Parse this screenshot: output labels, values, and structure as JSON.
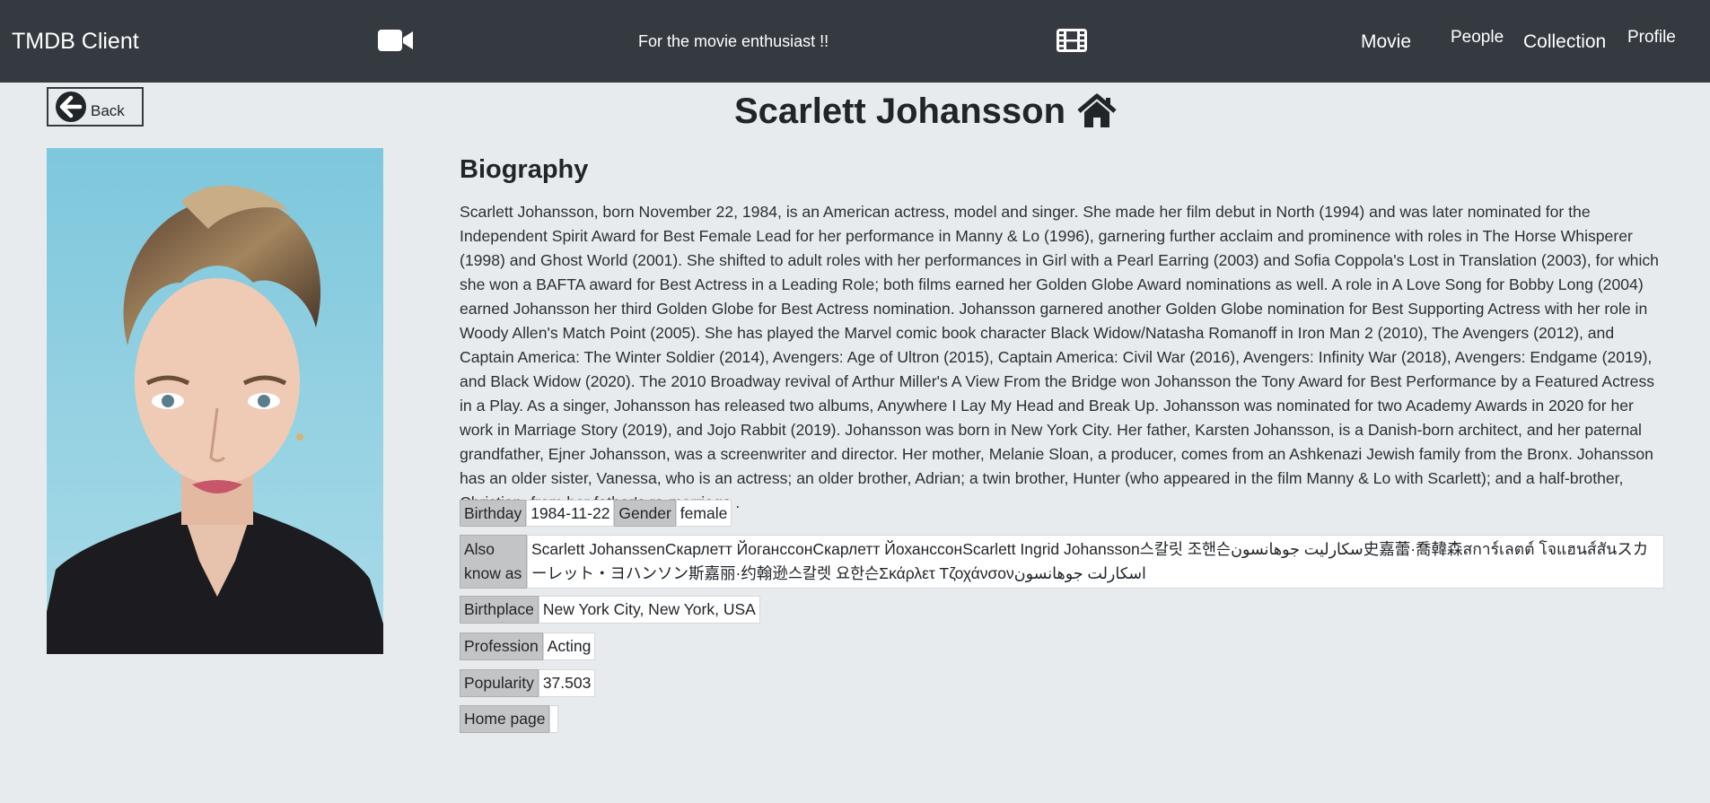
{
  "navbar": {
    "brand": "TMDB Client",
    "tagline": "For the movie enthusiast !!",
    "links": [
      "Movie",
      "People",
      "Collection",
      "Profile"
    ],
    "icons": [
      "video-camera-icon",
      "film-icon"
    ]
  },
  "back": {
    "label": "Back",
    "icon": "arrow-circle-left-icon"
  },
  "person": {
    "name": "Scarlett Johansson",
    "home_icon": "home-icon",
    "biography_heading": "Biography",
    "biography": "Scarlett Johansson, born November 22, 1984, is an American actress, model and singer. She made her film debut in North (1994) and was later nominated for the Independent Spirit Award for Best Female Lead for her performance in Manny & Lo (1996), garnering further acclaim and prominence with roles in The Horse Whisperer (1998) and Ghost World (2001). She shifted to adult roles with her performances in Girl with a Pearl Earring (2003) and Sofia Coppola's Lost in Translation (2003), for which she won a BAFTA award for Best Actress in a Leading Role; both films earned her Golden Globe Award nominations as well. A role in A Love Song for Bobby Long (2004) earned Johansson her third Golden Globe for Best Actress nomination. Johansson garnered another Golden Globe nomination for Best Supporting Actress with her role in Woody Allen's Match Point (2005). She has played the Marvel comic book character Black Widow/Natasha Romanoff in Iron Man 2 (2010), The Avengers (2012), and Captain America: The Winter Soldier (2014), Avengers: Age of Ultron (2015), Captain America: Civil War (2016), Avengers: Infinity War (2018), Avengers: Endgame (2019), and Black Widow (2020). The 2010 Broadway revival of Arthur Miller's A View From the Bridge won Johansson the Tony Award for Best Performance by a Featured Actress in a Play. As a singer, Johansson has released two albums, Anywhere I Lay My Head and Break Up. Johansson was nominated for two Academy Awards in 2020 for her work in Marriage Story (2019), and Jojo Rabbit (2019). Johansson was born in New York City. Her father, Karsten Johansson, is a Danish-born architect, and her paternal grandfather, Ejner Johansson, was a screenwriter and director. Her mother, Melanie Sloan, a producer, comes from an Ashkenazi Jewish family from the Bronx. Johansson has an older sister, Vanessa, who is an actress; an older brother, Adrian; a twin brother, Hunter (who appeared in the film Manny & Lo with Scarlett); and a half-brother, Christian, from her father's re-marriage .",
    "details": {
      "birthday_label": "Birthday",
      "birthday": "1984-11-22",
      "gender_label": "Gender",
      "gender": "female",
      "also_known_as_label": "Also know as",
      "also_known_as": "Scarlett JohanssenСкарлетт ЙоганссонСкарлетт ЙохансcонScarlett Ingrid Johansson스칼릿 조핸슨سكارليت جوهانسون史嘉蕾·喬韓森สการ์เลตต์ โจแฮนส์สันスカーレット・ヨハンソン斯嘉丽·约翰逊스칼렛 요한슨Σκάρλετ Τζοχάνσονاسكارلت جوهانسون",
      "birthplace_label": "Birthplace",
      "birthplace": "New York City, New York, USA",
      "profession_label": "Profession",
      "profession": "Acting",
      "popularity_label": "Popularity",
      "popularity": "37.503",
      "homepage_label": "Home page",
      "homepage": ""
    }
  },
  "colors": {
    "navbar": "#343a40",
    "background": "#e8ebee",
    "key_cell": "#c3c4c5"
  }
}
